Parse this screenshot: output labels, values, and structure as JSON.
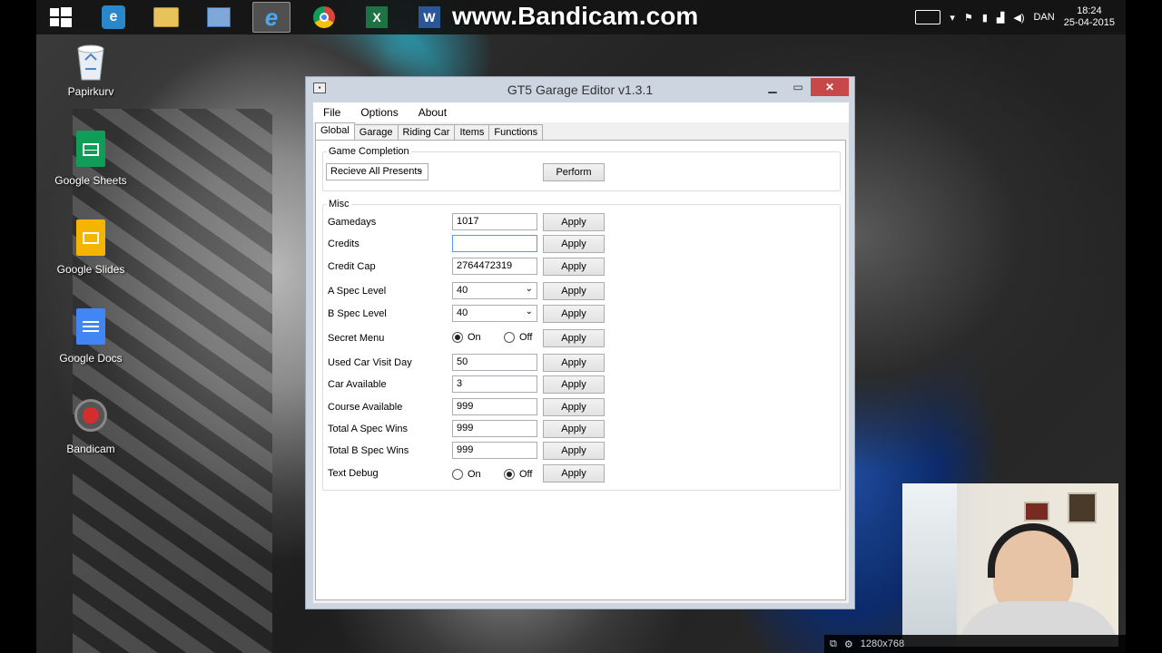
{
  "watermark": "www.Bandicam.com",
  "taskbar": {
    "apps": [
      "start",
      "internet-explorer-old",
      "file-explorer",
      "control-panel",
      "internet-explorer",
      "chrome",
      "excel",
      "word"
    ],
    "tray": {
      "language": "DAN",
      "time": "18:24",
      "date": "25-04-2015"
    }
  },
  "desktop": {
    "icons": [
      {
        "label": "Papirkurv",
        "icon": "recycle-bin-icon"
      },
      {
        "label": "Google Sheets",
        "icon": "google-sheets-icon"
      },
      {
        "label": "Google Slides",
        "icon": "google-slides-icon"
      },
      {
        "label": "Google Docs",
        "icon": "google-docs-icon"
      },
      {
        "label": "Bandicam",
        "icon": "bandicam-icon"
      }
    ]
  },
  "window": {
    "title": "GT5 Garage Editor v1.3.1",
    "menu": [
      "File",
      "Options",
      "About"
    ],
    "tabs": [
      "Global",
      "Garage",
      "Riding Car",
      "Items",
      "Functions"
    ],
    "game_completion": {
      "legend": "Game Completion",
      "select_value": "Recieve All Presents",
      "button": "Perform"
    },
    "misc": {
      "legend": "Misc",
      "apply": "Apply",
      "on": "On",
      "off": "Off",
      "rows": [
        {
          "label": "Gamedays",
          "value": "1017"
        },
        {
          "label": "Credits",
          "value": ""
        },
        {
          "label": "Credit Cap",
          "value": "2764472319"
        },
        {
          "label": "A Spec Level",
          "value": "40"
        },
        {
          "label": "B Spec Level",
          "value": "40"
        },
        {
          "label": "Secret Menu",
          "value": "On"
        },
        {
          "label": "Used Car Visit Day",
          "value": "50"
        },
        {
          "label": "Car Available",
          "value": "3"
        },
        {
          "label": "Course Available",
          "value": "999"
        },
        {
          "label": "Total A Spec Wins",
          "value": "999"
        },
        {
          "label": "Total B Spec Wins",
          "value": "999"
        },
        {
          "label": "Text Debug",
          "value": "Off"
        }
      ]
    }
  },
  "statusbar": {
    "resolution": "1280x768"
  }
}
